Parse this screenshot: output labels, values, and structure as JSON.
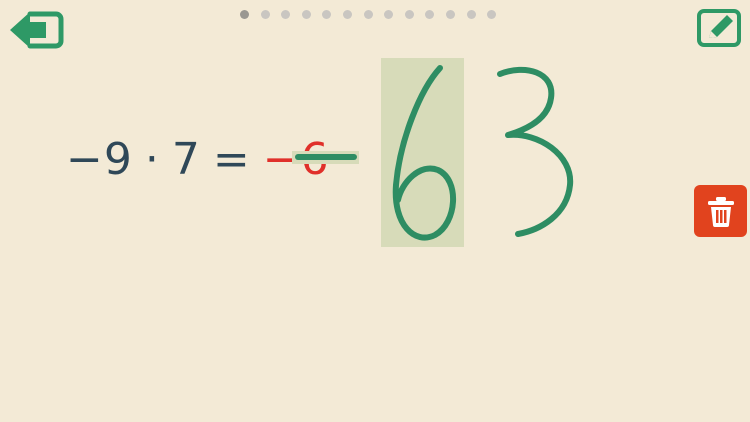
{
  "toolbar": {
    "back_icon": "arrow-left-exit-icon",
    "edit_icon": "pencil-edit-icon",
    "trash_icon": "trash-icon"
  },
  "progress": {
    "total_steps": 13,
    "current_step": 1
  },
  "equation": {
    "parts": [
      {
        "text": "−9",
        "color": "#2f4858"
      },
      {
        "text": "·",
        "color": "#2f4858"
      },
      {
        "text": "7",
        "color": "#2f4858"
      },
      {
        "text": "=",
        "color": "#2f4858"
      },
      {
        "text": "−6",
        "color": "#e0302a"
      }
    ]
  },
  "handwriting": {
    "strokes": [
      "−",
      "6",
      "3"
    ],
    "ink_color": "#2e8d63",
    "highlight_color": "#d7dbb9"
  },
  "colors": {
    "background": "#f3ead6",
    "accent": "#2e9966",
    "danger": "#e1431e",
    "dot": "#c9c6c1"
  }
}
